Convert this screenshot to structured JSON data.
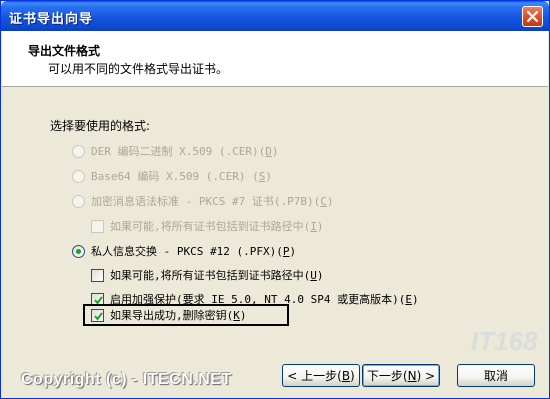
{
  "window": {
    "title": "证书导出向导"
  },
  "header": {
    "title": "导出文件格式",
    "subtitle": "可以用不同的文件格式导出证书。"
  },
  "prompt": "选择要使用的格式:",
  "options": [
    {
      "label": "DER 编码二进制 X.509 (.CER)",
      "key": "D",
      "selected": false,
      "enabled": false
    },
    {
      "label": "Base64 编码 X.509 (.CER)",
      "key": "S",
      "selected": false,
      "enabled": false
    },
    {
      "label": "加密消息语法标准 - PKCS #7 证书(.P7B)",
      "key": "C",
      "selected": false,
      "enabled": false
    },
    {
      "label": "私人信息交换 - PKCS #12 (.PFX)",
      "key": "P",
      "selected": true,
      "enabled": true
    }
  ],
  "checks": [
    {
      "label": "如果可能,将所有证书包括到证书路径中",
      "key": "I",
      "checked": false,
      "enabled": false
    },
    {
      "label": "如果可能,将所有证书包括到证书路径中",
      "key": "U",
      "checked": false,
      "enabled": true
    },
    {
      "label": "启用加强保护(要求 IE 5.0, NT 4.0 SP4 或更高版本)",
      "key": "E",
      "checked": true,
      "enabled": true
    },
    {
      "label": "如果导出成功,删除密钥",
      "key": "K",
      "checked": true,
      "enabled": true
    }
  ],
  "buttons": {
    "back": {
      "label": "< 上一步",
      "key": "B"
    },
    "next": {
      "label": "下一步",
      "key": "N"
    },
    "cancel": {
      "label": "取消"
    }
  },
  "watermark": "Copyright (c) - ITECN.NET",
  "logo": "IT168"
}
